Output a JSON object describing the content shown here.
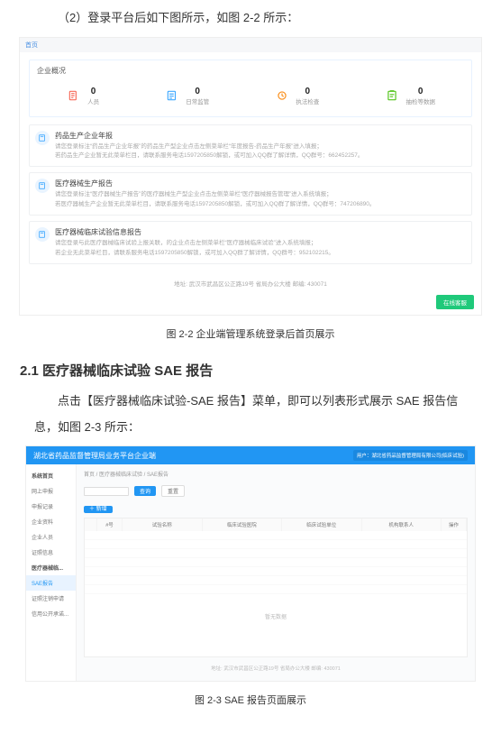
{
  "doc": {
    "p1": "（2）登录平台后如下图所示，如图 2-2 所示：",
    "caption22": "图 2-2 企业端管理系统登录后首页展示",
    "heading21": "2.1 医疗器械临床试验 SAE 报告",
    "p2": "点击【医疗器械临床试验-SAE 报告】菜单，即可以列表形式展示 SAE 报告信息，如图 2-3 所示：",
    "caption23": "图 2-3 SAE 报告页面展示"
  },
  "fig22": {
    "crumb": "首页",
    "overview_title": "企业概况",
    "stats": [
      {
        "num": "0",
        "label": "人员",
        "color": "#f86b5a"
      },
      {
        "num": "0",
        "label": "日常监管",
        "color": "#40a9ff"
      },
      {
        "num": "0",
        "label": "执法检查",
        "color": "#fa8c16"
      },
      {
        "num": "0",
        "label": "抽检等数据",
        "color": "#52c41a"
      }
    ],
    "notices": [
      {
        "title": "药品生产企业年报",
        "body1": "请您登录标注“药品生产企业年报”的药品生产型企业点击左侧菜单栏“年度报告-药品生产年报”进入填报；",
        "body2": "若药品生产企业暂无此菜单栏目，请联系服务电话1597205850解锁，或可加入QQ群了解详情，QQ群号：662452257。"
      },
      {
        "title": "医疗器械生产报告",
        "body1": "请您登录标注“医疗器械生产报告”的医疗器械生产型企业点击左侧菜单栏“医疗器械报告管理”进入系统填报；",
        "body2": "若医疗器械生产企业暂无此菜单栏目，请联系服务电话1597205850解锁，或可加入QQ群了解详情，QQ群号：747206890。"
      },
      {
        "title": "医疗器械临床试验信息报告",
        "body1": "请您登录与此医疗器械临床试验上报关联，的企业点击左侧菜单栏“医疗器械临床试验”进入系统填报；",
        "body2": "若企业无此菜单栏目，请联系服务电话1597205850解锁，或可加入QQ群了解详情，QQ群号：952102215。"
      }
    ],
    "address": "地址: 武汉市武昌区公正路19号 省局办公大楼 邮编: 430071",
    "btn_green": "在线客服"
  },
  "fig23": {
    "app_title": "湖北省药品监督管理局业务平台企业端",
    "user_badge": "用户：湖北省药品监督管理局有限公司(临床试验)",
    "sidebar": [
      "系统首页",
      "网上申报",
      "申报记录",
      "企业资料",
      "企业人员",
      "证照信息",
      "医疗器械临...",
      "SAE报告",
      "证照注销申请",
      "信用公开承诺..."
    ],
    "sidebar_active_index": 7,
    "crumb": "首页 / 医疗器械临床试验 / SAE报告",
    "btn_new": "＋ 新增",
    "btn_search": "查询",
    "btn_reset": "重置",
    "columns": [
      "",
      "#号",
      "试验名称",
      "临床试验医院",
      "临床试验单位",
      "机构联系人",
      "操作"
    ],
    "nodata": "暂无数据",
    "footer": "地址: 武汉市武昌区公正路19号 省局办公大楼 邮编: 430071"
  }
}
